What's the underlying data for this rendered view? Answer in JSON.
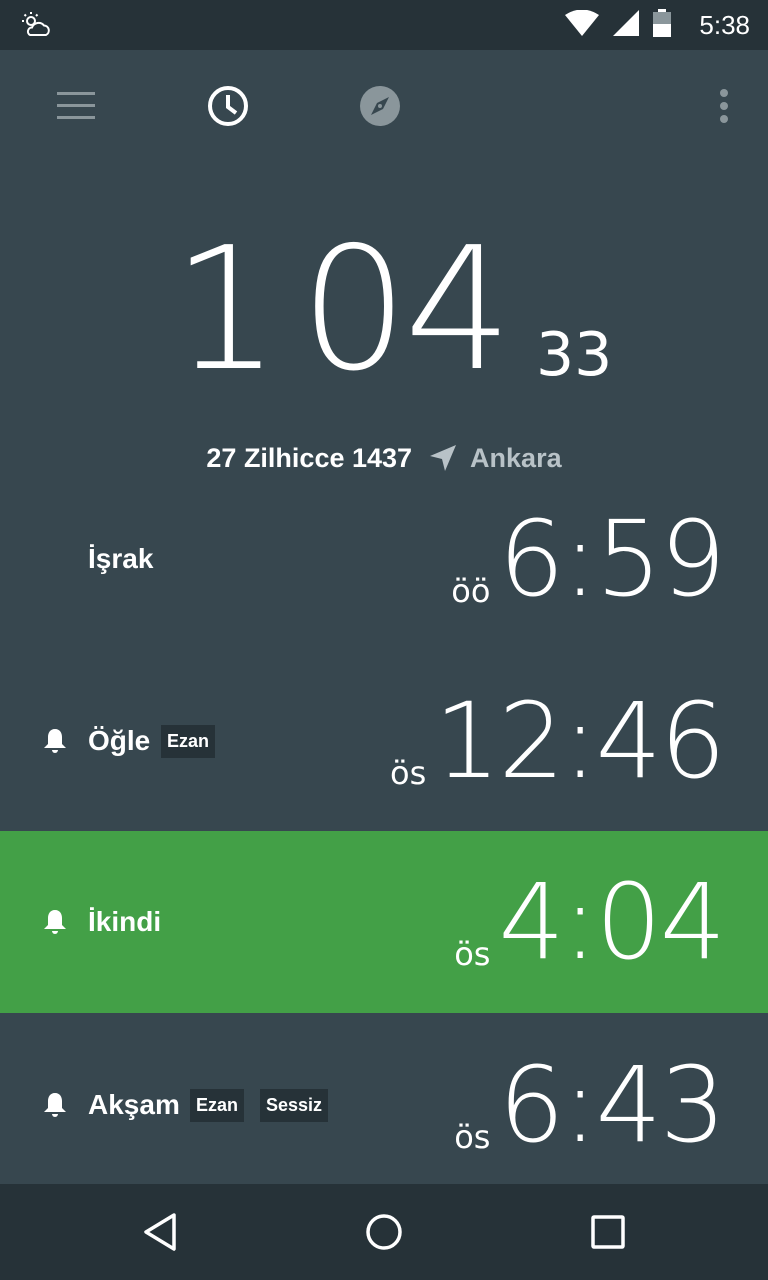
{
  "status_bar": {
    "time": "5:38",
    "icons": [
      "weather-icon",
      "wifi-icon",
      "signal-icon",
      "battery-icon"
    ]
  },
  "toolbar": {
    "icons": [
      "menu-icon",
      "clock-icon",
      "compass-icon",
      "more-vert-icon"
    ]
  },
  "countdown": {
    "hours": "1",
    "minutes": "04",
    "seconds": "33"
  },
  "dateline": {
    "date": "27 Zilhicce 1437",
    "location": "Ankara"
  },
  "prayers": [
    {
      "name": "İşrak",
      "ampm": "öö",
      "time": "6:59",
      "bell": false,
      "badges": [],
      "active": false
    },
    {
      "name": "Öğle",
      "ampm": "ös",
      "time": "12:46",
      "bell": true,
      "badges": [
        "Ezan"
      ],
      "active": false
    },
    {
      "name": "İkindi",
      "ampm": "ös",
      "time": "4:04",
      "bell": true,
      "badges": [],
      "active": true
    },
    {
      "name": "Akşam",
      "ampm": "ös",
      "time": "6:43",
      "bell": true,
      "badges": [
        "Ezan",
        "Sessiz"
      ],
      "active": false
    }
  ],
  "colors": {
    "background": "#37474f",
    "bars": "#263238",
    "active_row": "#43a047",
    "accent_gray": "#b8c2c7"
  }
}
